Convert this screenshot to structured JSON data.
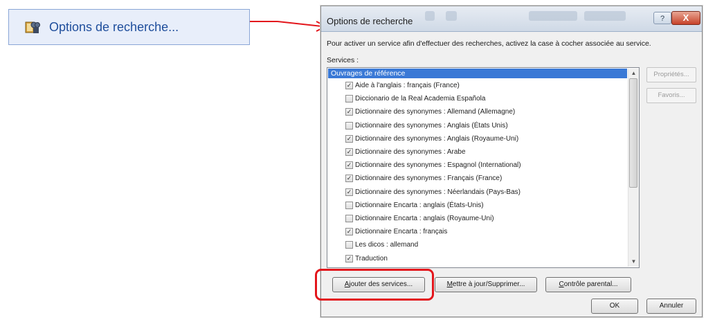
{
  "link": {
    "icon": "binoculars-book-icon",
    "label": "Options de recherche..."
  },
  "dialog": {
    "title": "Options de recherche",
    "help_label": "?",
    "close_label": "X",
    "description": "Pour activer un service afin d'effectuer des recherches, activez la case à cocher associée au service.",
    "services_label": "Services :",
    "list_header": "Ouvrages de référence",
    "services": [
      {
        "label": "Aide à l'anglais : français (France)",
        "checked": true
      },
      {
        "label": "Diccionario de la Real Academia Española",
        "checked": false
      },
      {
        "label": "Dictionnaire des synonymes : Allemand (Allemagne)",
        "checked": true
      },
      {
        "label": "Dictionnaire des synonymes : Anglais (États Unis)",
        "checked": false
      },
      {
        "label": "Dictionnaire des synonymes : Anglais (Royaume-Uni)",
        "checked": true
      },
      {
        "label": "Dictionnaire des synonymes : Arabe",
        "checked": true
      },
      {
        "label": "Dictionnaire des synonymes : Espagnol (International)",
        "checked": true
      },
      {
        "label": "Dictionnaire des synonymes : Français (France)",
        "checked": true
      },
      {
        "label": "Dictionnaire des synonymes : Néerlandais (Pays-Bas)",
        "checked": true
      },
      {
        "label": "Dictionnaire Encarta : anglais (États-Unis)",
        "checked": false
      },
      {
        "label": "Dictionnaire Encarta : anglais (Royaume-Uni)",
        "checked": false
      },
      {
        "label": "Dictionnaire Encarta : français",
        "checked": true
      },
      {
        "label": "Les dicos : allemand",
        "checked": false
      },
      {
        "label": "Traduction",
        "checked": true
      }
    ],
    "side_buttons": {
      "properties": "Propriétés...",
      "favorites": "Favoris..."
    },
    "buttons": {
      "add_services_prefix": "A",
      "add_services_rest": "jouter des services...",
      "update_remove_prefix": "M",
      "update_remove_rest": "ettre à jour/Supprimer...",
      "parental_prefix": "C",
      "parental_rest": "ontrôle parental...",
      "ok": "OK",
      "cancel": "Annuler"
    }
  },
  "colors": {
    "highlight": "#e3161c",
    "selection": "#3a79d6",
    "link_text": "#1f4e9c"
  }
}
